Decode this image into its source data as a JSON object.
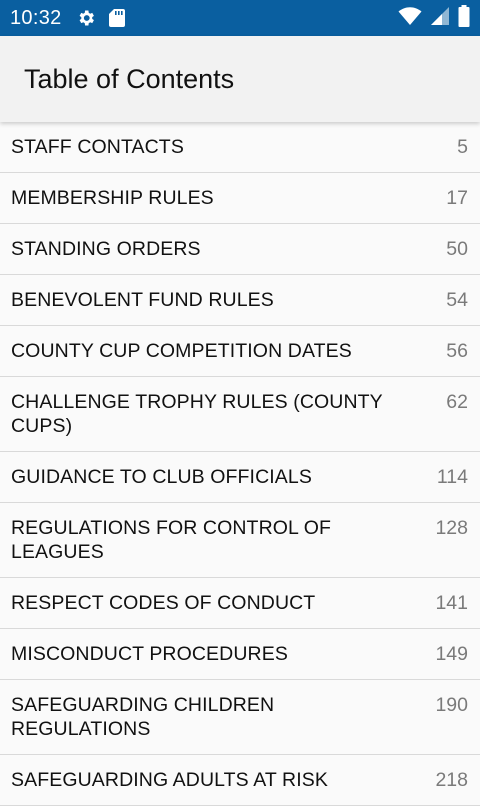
{
  "status_bar": {
    "time": "10:32",
    "icons_left": [
      "settings-icon",
      "sd-card-icon"
    ],
    "icons_right": [
      "wifi-icon",
      "signal-icon",
      "battery-icon"
    ],
    "background": "#0a5fa0"
  },
  "app_bar": {
    "title": "Table of Contents"
  },
  "toc": {
    "items": [
      {
        "title": "STAFF CONTACTS",
        "page": "5"
      },
      {
        "title": "MEMBERSHIP RULES",
        "page": "17"
      },
      {
        "title": "STANDING ORDERS",
        "page": "50"
      },
      {
        "title": "BENEVOLENT FUND RULES",
        "page": "54"
      },
      {
        "title": "COUNTY CUP COMPETITION DATES",
        "page": "56"
      },
      {
        "title": "CHALLENGE TROPHY RULES (COUNTY CUPS)",
        "page": "62"
      },
      {
        "title": "GUIDANCE TO CLUB OFFICIALS",
        "page": "114"
      },
      {
        "title": "REGULATIONS FOR CONTROL OF LEAGUES",
        "page": "128"
      },
      {
        "title": "RESPECT CODES OF CONDUCT",
        "page": "141"
      },
      {
        "title": "MISCONDUCT PROCEDURES",
        "page": "149"
      },
      {
        "title": "SAFEGUARDING CHILDREN REGULATIONS",
        "page": "190"
      },
      {
        "title": "SAFEGUARDING ADULTS AT RISK",
        "page": "218"
      }
    ]
  }
}
